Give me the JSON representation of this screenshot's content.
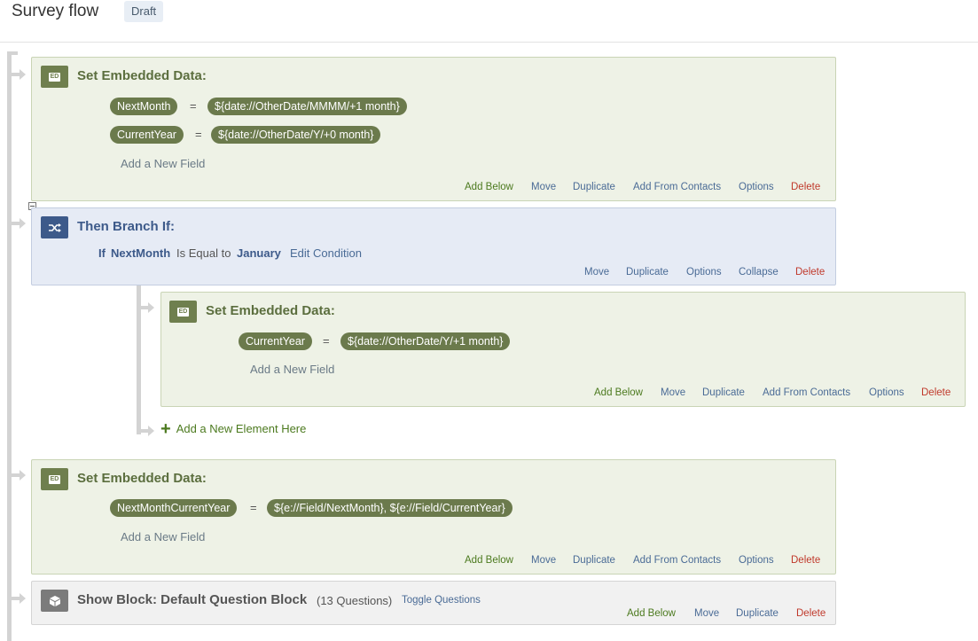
{
  "header": {
    "title": "Survey flow",
    "status": "Draft"
  },
  "blocks": [
    {
      "title": "Set Embedded Data:",
      "icon": "embedded-data-icon",
      "icon_text": "ED",
      "fields": [
        {
          "name": "NextMonth",
          "value": "${date://OtherDate/MMMM/+1 month}"
        },
        {
          "name": "CurrentYear",
          "value": "${date://OtherDate/Y/+0 month}"
        }
      ],
      "add_field": "Add a New Field",
      "actions": [
        "Add Below",
        "Move",
        "Duplicate",
        "Add From Contacts",
        "Options",
        "Delete"
      ]
    },
    {
      "title": "Then Branch If:",
      "icon": "branch-icon",
      "condition": {
        "if": "If",
        "field": "NextMonth",
        "operator": "Is Equal to",
        "value": "January",
        "edit": "Edit Condition"
      },
      "actions": [
        "Move",
        "Duplicate",
        "Options",
        "Collapse",
        "Delete"
      ],
      "children": [
        {
          "title": "Set Embedded Data:",
          "icon": "embedded-data-icon",
          "icon_text": "ED",
          "fields": [
            {
              "name": "CurrentYear",
              "value": "${date://OtherDate/Y/+1 month}"
            }
          ],
          "add_field": "Add a New Field",
          "actions": [
            "Add Below",
            "Move",
            "Duplicate",
            "Add From Contacts",
            "Options",
            "Delete"
          ]
        }
      ],
      "add_element": "Add a New Element Here"
    },
    {
      "title": "Set Embedded Data:",
      "icon": "embedded-data-icon",
      "icon_text": "ED",
      "fields": [
        {
          "name": "NextMonthCurrentYear",
          "value": "${e://Field/NextMonth}, ${e://Field/CurrentYear}"
        }
      ],
      "add_field": "Add a New Field",
      "actions": [
        "Add Below",
        "Move",
        "Duplicate",
        "Add From Contacts",
        "Options",
        "Delete"
      ]
    },
    {
      "title": "Show Block: Default Question Block",
      "icon": "block-cube-icon",
      "count": "(13 Questions)",
      "toggle": "Toggle Questions",
      "actions": [
        "Add Below",
        "Move",
        "Duplicate",
        "Delete"
      ]
    }
  ],
  "equals_sign": "=",
  "colors": {
    "embedded_data": "#6f7f4e",
    "branch": "#3d5a8a",
    "block": "#7b7b7b",
    "delete": "#c0392b",
    "add_below": "#4c7a1f"
  }
}
